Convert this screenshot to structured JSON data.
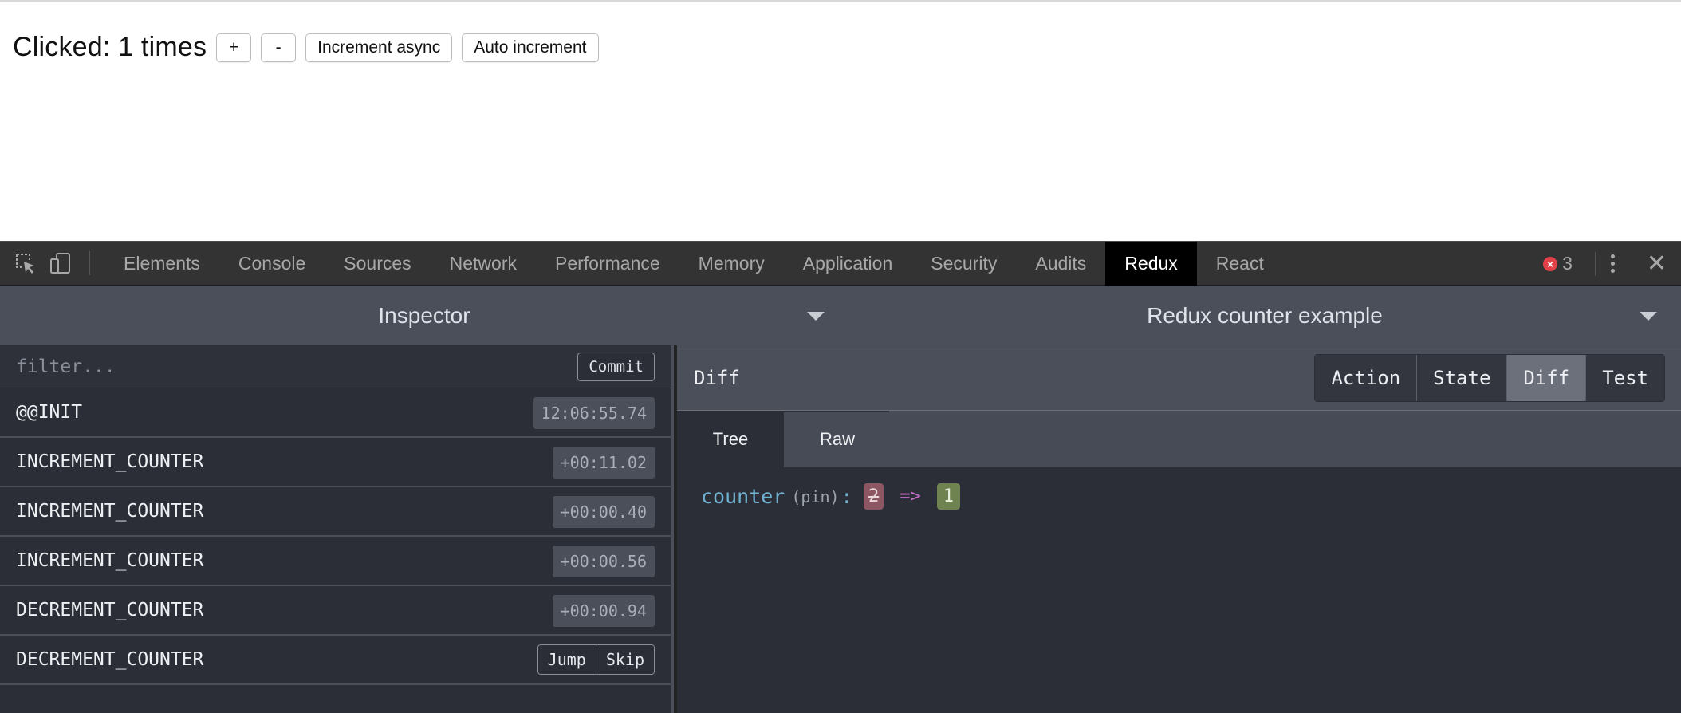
{
  "app": {
    "clicked_text": "Clicked: 1 times",
    "buttons": {
      "plus": "+",
      "minus": "-",
      "increment_async": "Increment async",
      "auto_increment": "Auto increment"
    }
  },
  "devtools": {
    "tabs": [
      "Elements",
      "Console",
      "Sources",
      "Network",
      "Performance",
      "Memory",
      "Application",
      "Security",
      "Audits",
      "Redux",
      "React"
    ],
    "active_tab": "Redux",
    "error_count": "3",
    "icons": {
      "inspect": "inspect-element-icon",
      "device": "device-toolbar-icon",
      "error": "error-icon",
      "more": "more-options-icon",
      "close": "close-icon"
    }
  },
  "redux": {
    "monitor": "Inspector",
    "instance": "Redux counter example",
    "filter_placeholder": "filter...",
    "commit_label": "Commit",
    "actions": [
      {
        "name": "@@INIT",
        "time": "12:06:55.74"
      },
      {
        "name": "INCREMENT_COUNTER",
        "time": "+00:11.02"
      },
      {
        "name": "INCREMENT_COUNTER",
        "time": "+00:00.40"
      },
      {
        "name": "INCREMENT_COUNTER",
        "time": "+00:00.56"
      },
      {
        "name": "DECREMENT_COUNTER",
        "time": "+00:00.94"
      },
      {
        "name": "DECREMENT_COUNTER",
        "jump": "Jump",
        "skip": "Skip"
      }
    ],
    "detail": {
      "title": "Diff",
      "modes": [
        "Action",
        "State",
        "Diff",
        "Test"
      ],
      "active_mode": "Diff",
      "subtabs": [
        "Tree",
        "Raw"
      ],
      "active_subtab": "Tree",
      "diff": {
        "key": "counter",
        "pin": "(pin)",
        "colon": ":",
        "old_value": "2",
        "arrow": "=>",
        "new_value": "1"
      }
    }
  },
  "colors": {
    "devtools_toolbar": "#333333",
    "active_tab_bg": "#000000",
    "redux_header": "#4a4f5a",
    "pane_bg": "#2b2e36",
    "diff_key": "#6fb3d2",
    "old_value_bg": "#8c5763",
    "new_value_bg": "#6f8350",
    "error_red": "#e0424a"
  }
}
